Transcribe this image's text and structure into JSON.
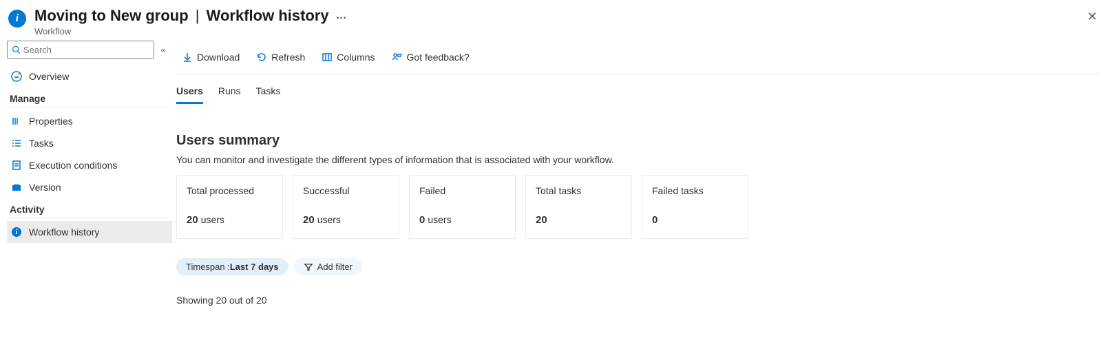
{
  "header": {
    "title_left": "Moving to New group",
    "title_right": "Workflow history",
    "subtitle": "Workflow",
    "more": "…"
  },
  "sidebar": {
    "search_placeholder": "Search",
    "collapse_glyph": "«",
    "overview_label": "Overview",
    "section_manage": "Manage",
    "items_manage": [
      {
        "label": "Properties"
      },
      {
        "label": "Tasks"
      },
      {
        "label": "Execution conditions"
      },
      {
        "label": "Version"
      }
    ],
    "section_activity": "Activity",
    "items_activity": [
      {
        "label": "Workflow history"
      }
    ]
  },
  "toolbar": {
    "download": "Download",
    "refresh": "Refresh",
    "columns": "Columns",
    "feedback": "Got feedback?"
  },
  "tabs": [
    "Users",
    "Runs",
    "Tasks"
  ],
  "summary": {
    "title": "Users summary",
    "desc": "You can monitor and investigate the different types of information that is associated with your workflow.",
    "cards": [
      {
        "title": "Total processed",
        "value": "20",
        "unit": "users"
      },
      {
        "title": "Successful",
        "value": "20",
        "unit": "users"
      },
      {
        "title": "Failed",
        "value": "0",
        "unit": "users"
      },
      {
        "title": "Total tasks",
        "value": "20",
        "unit": ""
      },
      {
        "title": "Failed tasks",
        "value": "0",
        "unit": ""
      }
    ]
  },
  "filters": {
    "timespan_label": "Timespan : ",
    "timespan_value": "Last 7 days",
    "add_filter": "Add filter"
  },
  "showing": "Showing 20 out of 20"
}
